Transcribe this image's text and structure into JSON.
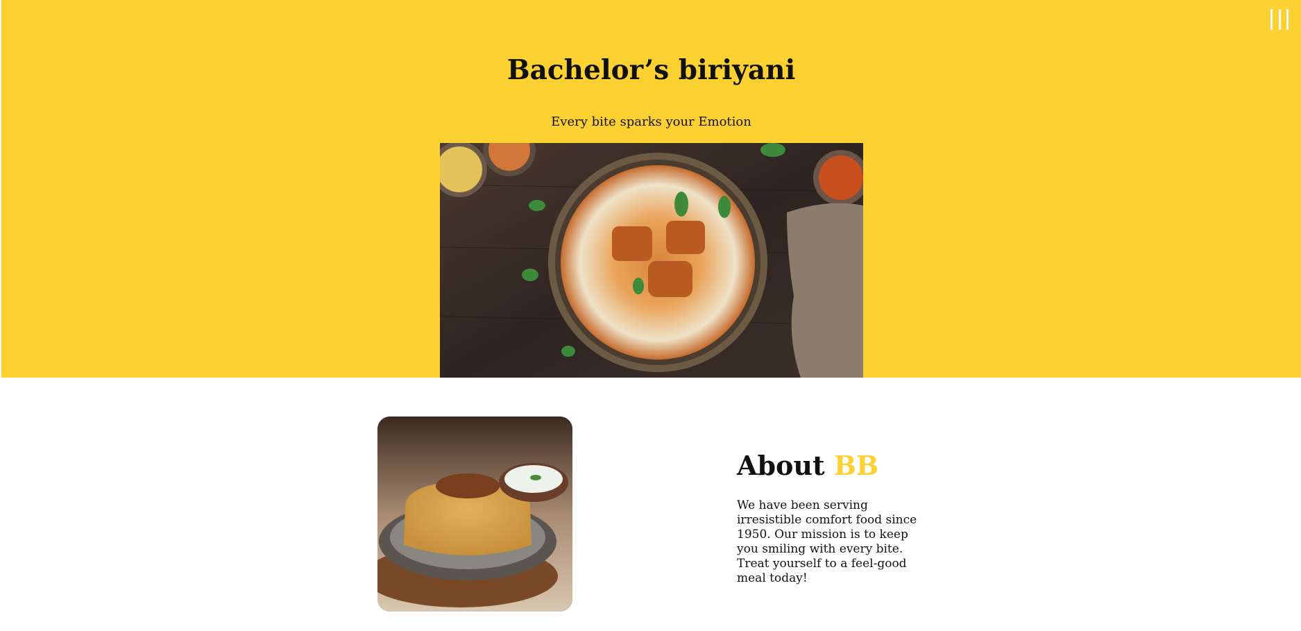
{
  "header": {
    "title": "Bachelor’s biriyani",
    "tagline": "Every bite sparks your Emotion",
    "menu_icon": "hamburger-menu-icon"
  },
  "about": {
    "title_prefix": "About",
    "title_accent": "BB",
    "text": "We have been serving irresistible comfort food since 1950. Our mission is to keep you smiling with every bite. Treat yourself to a feel-good meal today!"
  },
  "colors": {
    "brand_yellow": "#fdd131",
    "text": "#111111",
    "background": "#ffffff"
  }
}
